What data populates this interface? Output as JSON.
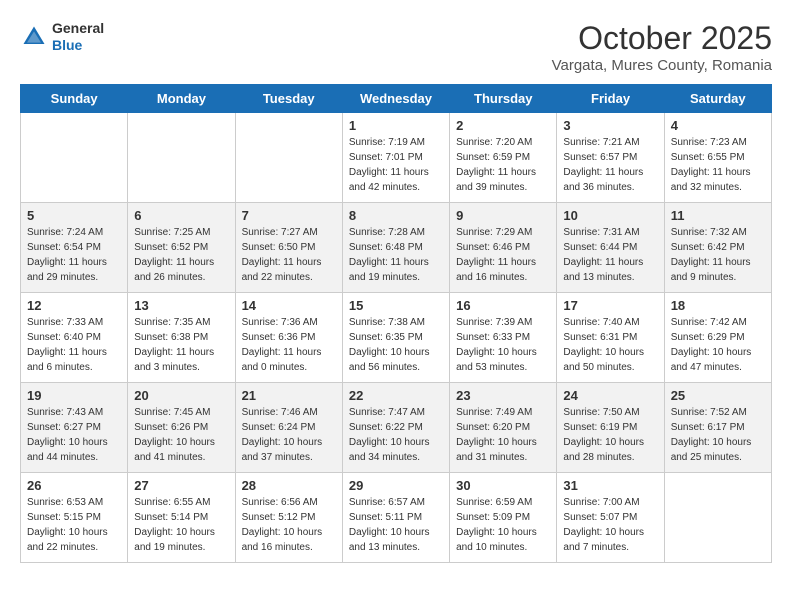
{
  "header": {
    "logo_general": "General",
    "logo_blue": "Blue",
    "title": "October 2025",
    "subtitle": "Vargata, Mures County, Romania"
  },
  "calendar": {
    "days_of_week": [
      "Sunday",
      "Monday",
      "Tuesday",
      "Wednesday",
      "Thursday",
      "Friday",
      "Saturday"
    ],
    "rows": [
      [
        {
          "day": "",
          "info": ""
        },
        {
          "day": "",
          "info": ""
        },
        {
          "day": "",
          "info": ""
        },
        {
          "day": "1",
          "info": "Sunrise: 7:19 AM\nSunset: 7:01 PM\nDaylight: 11 hours and 42 minutes."
        },
        {
          "day": "2",
          "info": "Sunrise: 7:20 AM\nSunset: 6:59 PM\nDaylight: 11 hours and 39 minutes."
        },
        {
          "day": "3",
          "info": "Sunrise: 7:21 AM\nSunset: 6:57 PM\nDaylight: 11 hours and 36 minutes."
        },
        {
          "day": "4",
          "info": "Sunrise: 7:23 AM\nSunset: 6:55 PM\nDaylight: 11 hours and 32 minutes."
        }
      ],
      [
        {
          "day": "5",
          "info": "Sunrise: 7:24 AM\nSunset: 6:54 PM\nDaylight: 11 hours and 29 minutes."
        },
        {
          "day": "6",
          "info": "Sunrise: 7:25 AM\nSunset: 6:52 PM\nDaylight: 11 hours and 26 minutes."
        },
        {
          "day": "7",
          "info": "Sunrise: 7:27 AM\nSunset: 6:50 PM\nDaylight: 11 hours and 22 minutes."
        },
        {
          "day": "8",
          "info": "Sunrise: 7:28 AM\nSunset: 6:48 PM\nDaylight: 11 hours and 19 minutes."
        },
        {
          "day": "9",
          "info": "Sunrise: 7:29 AM\nSunset: 6:46 PM\nDaylight: 11 hours and 16 minutes."
        },
        {
          "day": "10",
          "info": "Sunrise: 7:31 AM\nSunset: 6:44 PM\nDaylight: 11 hours and 13 minutes."
        },
        {
          "day": "11",
          "info": "Sunrise: 7:32 AM\nSunset: 6:42 PM\nDaylight: 11 hours and 9 minutes."
        }
      ],
      [
        {
          "day": "12",
          "info": "Sunrise: 7:33 AM\nSunset: 6:40 PM\nDaylight: 11 hours and 6 minutes."
        },
        {
          "day": "13",
          "info": "Sunrise: 7:35 AM\nSunset: 6:38 PM\nDaylight: 11 hours and 3 minutes."
        },
        {
          "day": "14",
          "info": "Sunrise: 7:36 AM\nSunset: 6:36 PM\nDaylight: 11 hours and 0 minutes."
        },
        {
          "day": "15",
          "info": "Sunrise: 7:38 AM\nSunset: 6:35 PM\nDaylight: 10 hours and 56 minutes."
        },
        {
          "day": "16",
          "info": "Sunrise: 7:39 AM\nSunset: 6:33 PM\nDaylight: 10 hours and 53 minutes."
        },
        {
          "day": "17",
          "info": "Sunrise: 7:40 AM\nSunset: 6:31 PM\nDaylight: 10 hours and 50 minutes."
        },
        {
          "day": "18",
          "info": "Sunrise: 7:42 AM\nSunset: 6:29 PM\nDaylight: 10 hours and 47 minutes."
        }
      ],
      [
        {
          "day": "19",
          "info": "Sunrise: 7:43 AM\nSunset: 6:27 PM\nDaylight: 10 hours and 44 minutes."
        },
        {
          "day": "20",
          "info": "Sunrise: 7:45 AM\nSunset: 6:26 PM\nDaylight: 10 hours and 41 minutes."
        },
        {
          "day": "21",
          "info": "Sunrise: 7:46 AM\nSunset: 6:24 PM\nDaylight: 10 hours and 37 minutes."
        },
        {
          "day": "22",
          "info": "Sunrise: 7:47 AM\nSunset: 6:22 PM\nDaylight: 10 hours and 34 minutes."
        },
        {
          "day": "23",
          "info": "Sunrise: 7:49 AM\nSunset: 6:20 PM\nDaylight: 10 hours and 31 minutes."
        },
        {
          "day": "24",
          "info": "Sunrise: 7:50 AM\nSunset: 6:19 PM\nDaylight: 10 hours and 28 minutes."
        },
        {
          "day": "25",
          "info": "Sunrise: 7:52 AM\nSunset: 6:17 PM\nDaylight: 10 hours and 25 minutes."
        }
      ],
      [
        {
          "day": "26",
          "info": "Sunrise: 6:53 AM\nSunset: 5:15 PM\nDaylight: 10 hours and 22 minutes."
        },
        {
          "day": "27",
          "info": "Sunrise: 6:55 AM\nSunset: 5:14 PM\nDaylight: 10 hours and 19 minutes."
        },
        {
          "day": "28",
          "info": "Sunrise: 6:56 AM\nSunset: 5:12 PM\nDaylight: 10 hours and 16 minutes."
        },
        {
          "day": "29",
          "info": "Sunrise: 6:57 AM\nSunset: 5:11 PM\nDaylight: 10 hours and 13 minutes."
        },
        {
          "day": "30",
          "info": "Sunrise: 6:59 AM\nSunset: 5:09 PM\nDaylight: 10 hours and 10 minutes."
        },
        {
          "day": "31",
          "info": "Sunrise: 7:00 AM\nSunset: 5:07 PM\nDaylight: 10 hours and 7 minutes."
        },
        {
          "day": "",
          "info": ""
        }
      ]
    ]
  }
}
